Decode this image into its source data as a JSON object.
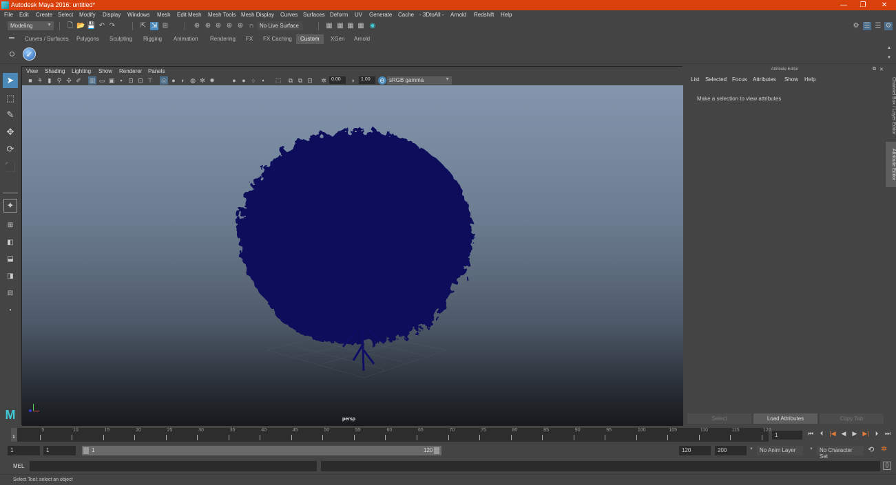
{
  "window": {
    "title": "Autodesk Maya 2016: untitled*",
    "controls": {
      "minimize": "—",
      "restore": "❐",
      "close": "✕"
    }
  },
  "menubar": {
    "items": [
      "File",
      "Edit",
      "Create",
      "Select",
      "Modify",
      "Display",
      "Windows",
      "Mesh",
      "Edit Mesh",
      "Mesh Tools",
      "Mesh Display",
      "Curves",
      "Surfaces",
      "Deform",
      "UV",
      "Generate",
      "Cache",
      "- 3DtoAll -",
      "Arnold",
      "Redshift",
      "Help"
    ]
  },
  "statusline": {
    "menuset": "Modeling",
    "live_surface": "No Live Surface"
  },
  "shelf": {
    "tabs": [
      "Curves / Surfaces",
      "Polygons",
      "Sculpting",
      "Rigging",
      "Animation",
      "Rendering",
      "FX",
      "FX Caching",
      "Custom",
      "XGen",
      "Arnold"
    ],
    "active_tab": "Custom"
  },
  "viewport": {
    "menu": [
      "View",
      "Shading",
      "Lighting",
      "Show",
      "Renderer",
      "Panels"
    ],
    "exposure": "0.00",
    "gamma": "1.00",
    "color_space": "sRGB gamma",
    "camera_label": "persp",
    "colors": {
      "wireframe": "#0a0a5c",
      "bg_top": "#8396ad",
      "bg_bottom": "#17191c"
    }
  },
  "attribute_editor": {
    "title": "Attribute Editor",
    "menu": [
      "List",
      "Selected",
      "Focus",
      "Attributes",
      "Show",
      "Help"
    ],
    "message": "Make a selection to view attributes",
    "buttons": {
      "select": "Select",
      "load": "Load Attributes",
      "copy": "Copy Tab"
    }
  },
  "side_tabs": {
    "channel_box": "Channel Box / Layer Editor",
    "attribute_editor": "Attribute Editor"
  },
  "timeline": {
    "ticks": [
      "5",
      "10",
      "15",
      "20",
      "25",
      "30",
      "35",
      "40",
      "45",
      "50",
      "55",
      "60",
      "65",
      "70",
      "75",
      "80",
      "85",
      "90",
      "95",
      "100",
      "105",
      "110",
      "115",
      "120"
    ],
    "current_frame_marker": "1",
    "current_frame": "1"
  },
  "range": {
    "start": "1",
    "playback_start": "1",
    "slider_start": "1",
    "slider_end": "120",
    "playback_end": "120",
    "end": "200",
    "anim_layer": "No Anim Layer",
    "character_set": "No Character Set"
  },
  "command_line": {
    "language": "MEL"
  },
  "help_line": {
    "text": "Select Tool: select an object"
  },
  "accent": "#4b8ab8"
}
